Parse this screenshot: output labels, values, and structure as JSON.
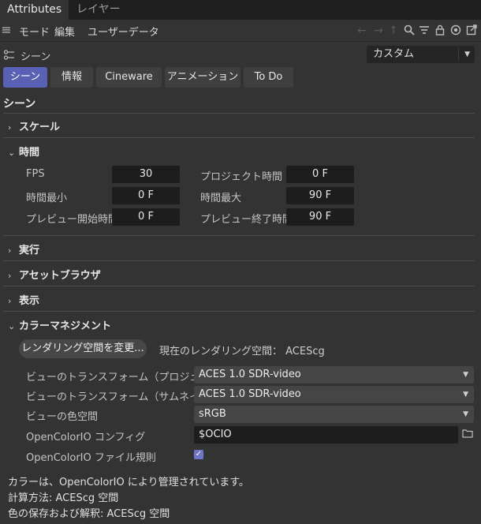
{
  "window_tabs": [
    "Attributes",
    "レイヤー"
  ],
  "menu": {
    "items": [
      "モード",
      "編集",
      "ユーザーデータ"
    ],
    "icons": [
      "hamburger-icon",
      "arrow-left-icon",
      "arrow-right-icon",
      "arrow-up-icon",
      "search-icon",
      "filter-icon",
      "lock-icon",
      "target-icon",
      "new-window-icon"
    ]
  },
  "scene": {
    "label": "シーン",
    "preset": "カスタム"
  },
  "tabs": [
    "シーン",
    "情報",
    "Cineware",
    "アニメーション",
    "To Do"
  ],
  "active_tab": "シーン",
  "title": "シーン",
  "sections": {
    "scale": "スケール",
    "time": "時間",
    "execute": "実行",
    "asset_browser": "アセットブラウザ",
    "display": "表示",
    "color_management": "カラーマネジメント"
  },
  "time": {
    "fps": {
      "label": "FPS",
      "value": "30"
    },
    "project_time": {
      "label": "プロジェクト時間",
      "value": "0 F"
    },
    "min_time": {
      "label": "時間最小",
      "value": "0 F"
    },
    "max_time": {
      "label": "時間最大",
      "value": "90 F"
    },
    "preview_start": {
      "label": "プレビュー開始時間",
      "value": "0 F"
    },
    "preview_end": {
      "label": "プレビュー終了時間",
      "value": "90 F"
    }
  },
  "color": {
    "change_button": "レンダリング空間を変更...",
    "current_space": "現在のレンダリング空間： ACEScg",
    "view_transform_project": {
      "label": "ビューのトランスフォーム（プロジェクト）",
      "value": "ACES 1.0 SDR-video"
    },
    "view_transform_thumbnail": {
      "label": "ビューのトランスフォーム（サムネイル）",
      "value": "ACES 1.0 SDR-video"
    },
    "view_color_space": {
      "label": "ビューの色空間",
      "value": "sRGB"
    },
    "ocio_config": {
      "label": "OpenColorIO コンフィグ",
      "value": "$OCIO"
    },
    "ocio_file_rules": {
      "label": "OpenColorIO ファイル規則",
      "checked": true
    }
  },
  "notes": [
    "カラーは、OpenColorIO により管理されています。",
    "計算方法: ACEScg 空間",
    "色の保存および解釈: ACEScg 空間"
  ]
}
